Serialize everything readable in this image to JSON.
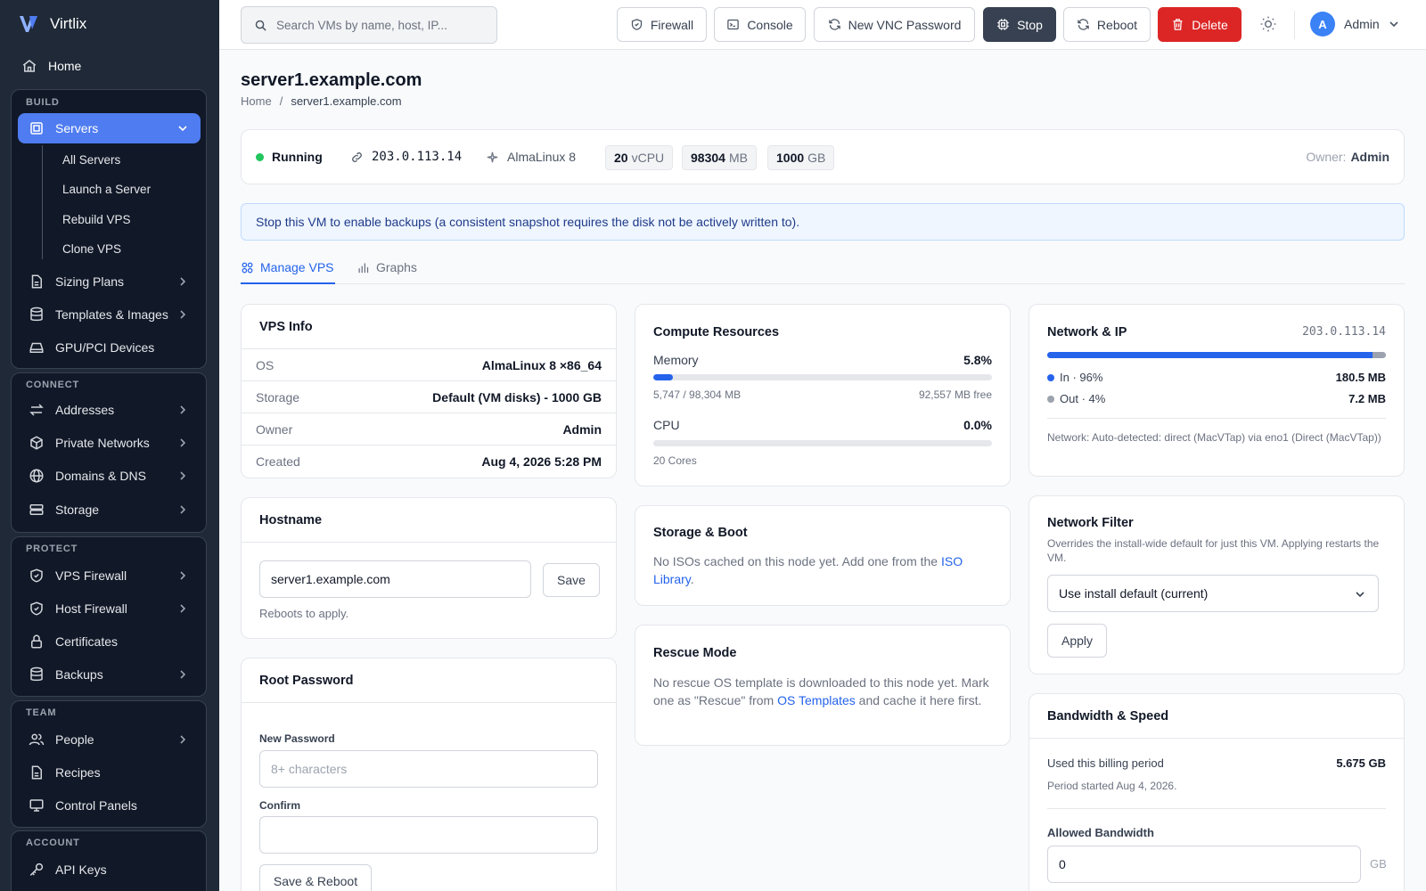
{
  "brand": {
    "name": "Virtlix",
    "accent": "#4f7cf0"
  },
  "sidebar": {
    "home": "Home",
    "build": {
      "title": "BUILD",
      "servers": "Servers",
      "sub": [
        "All Servers",
        "Launch a Server",
        "Rebuild VPS",
        "Clone VPS"
      ],
      "items": [
        "Sizing Plans",
        "Templates & Images",
        "GPU/PCI Devices"
      ]
    },
    "connect": {
      "title": "CONNECT",
      "items": [
        "Addresses",
        "Private Networks",
        "Domains & DNS",
        "Storage"
      ]
    },
    "protect": {
      "title": "PROTECT",
      "items": [
        "VPS Firewall",
        "Host Firewall",
        "Certificates",
        "Backups"
      ]
    },
    "team": {
      "title": "TEAM",
      "items": [
        "People",
        "Recipes",
        "Control Panels"
      ]
    },
    "account": {
      "title": "ACCOUNT",
      "items": [
        "API Keys"
      ]
    }
  },
  "topbar": {
    "search_placeholder": "Search VMs by name, host, IP...",
    "firewall": "Firewall",
    "console": "Console",
    "vnc": "New VNC Password",
    "stop": "Stop",
    "reboot": "Reboot",
    "delete": "Delete",
    "avatar": "A",
    "user": "Admin"
  },
  "page": {
    "title": "server1.example.com",
    "breadcrumb": {
      "home": "Home",
      "sep": "/",
      "current": "server1.example.com"
    }
  },
  "status": {
    "state": "Running",
    "ip": "203.0.113.14",
    "os": "AlmaLinux 8",
    "vcpu": {
      "value": "20",
      "unit": "vCPU"
    },
    "ram": {
      "value": "98304",
      "unit": "MB"
    },
    "disk": {
      "value": "1000",
      "unit": "GB"
    },
    "owner_label": "Owner:",
    "owner": "Admin"
  },
  "alert": "Stop this VM to enable backups (a consistent snapshot requires the disk not be actively written to).",
  "tabs": {
    "manage": "Manage VPS",
    "graphs": "Graphs"
  },
  "vps_info": {
    "title": "VPS Info",
    "rows": [
      {
        "k": "OS",
        "v": "AlmaLinux 8 ×86_64"
      },
      {
        "k": "Storage",
        "v": "Default (VM disks) - 1000 GB"
      },
      {
        "k": "Owner",
        "v": "Admin"
      },
      {
        "k": "Created",
        "v": "Aug 4, 2026 5:28 PM"
      }
    ]
  },
  "hostname": {
    "title": "Hostname",
    "value": "server1.example.com",
    "save": "Save",
    "note": "Reboots to apply."
  },
  "root_password": {
    "title": "Root Password",
    "new_label": "New Password",
    "new_placeholder": "8+ characters",
    "confirm_label": "Confirm",
    "save": "Save & Reboot"
  },
  "compute": {
    "title": "Compute Resources",
    "memory": {
      "label": "Memory",
      "pct": "5.8%",
      "fraction": 0.058,
      "used": "5,747 / 98,304 MB",
      "free": "92,557 MB free"
    },
    "cpu": {
      "label": "CPU",
      "pct": "0.0%",
      "fraction": 0.0,
      "cores": "20 Cores"
    }
  },
  "storage_boot": {
    "title": "Storage & Boot",
    "text": "No ISOs cached on this node yet. Add one from the ",
    "link": "ISO Library",
    "end": "."
  },
  "rescue": {
    "title": "Rescue Mode",
    "text": "No rescue OS template is downloaded to this node yet. Mark one as \"Rescue\" from ",
    "link": "OS Templates",
    "end": " and cache it here first."
  },
  "network": {
    "title": "Network & IP",
    "ip": "203.0.113.14",
    "in": {
      "label": "In · 96%",
      "value": "180.5 MB",
      "fraction": 0.96,
      "color": "#2563eb"
    },
    "out": {
      "label": "Out · 4%",
      "value": "7.2 MB",
      "fraction": 0.04,
      "color": "#9ca3af"
    },
    "note": "Network: Auto-detected: direct (MacVTap) via eno1 (Direct (MacVTap))"
  },
  "network_filter": {
    "title": "Network Filter",
    "desc": "Overrides the install-wide default for just this VM. Applying restarts the VM.",
    "selected": "Use install default (current)",
    "apply": "Apply"
  },
  "bandwidth": {
    "title": "Bandwidth & Speed",
    "used_label": "Used this billing period",
    "used_value": "5.675 GB",
    "period": "Period started Aug 4, 2026.",
    "allowed_label": "Allowed Bandwidth",
    "allowed_value": "0",
    "allowed_unit": "GB"
  }
}
